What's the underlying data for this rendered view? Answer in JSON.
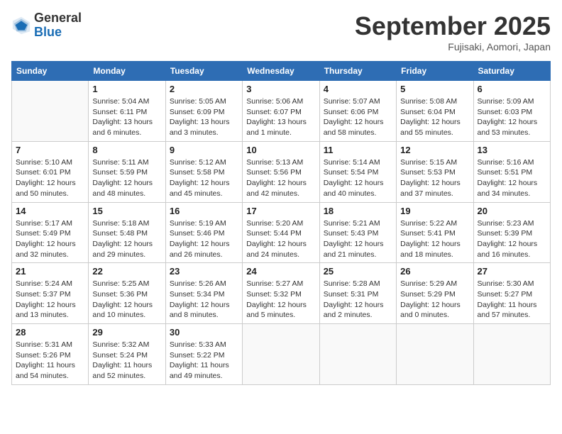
{
  "header": {
    "logo": {
      "general": "General",
      "blue": "Blue"
    },
    "title": "September 2025",
    "subtitle": "Fujisaki, Aomori, Japan"
  },
  "days_of_week": [
    "Sunday",
    "Monday",
    "Tuesday",
    "Wednesday",
    "Thursday",
    "Friday",
    "Saturday"
  ],
  "weeks": [
    [
      {
        "day": "",
        "info": ""
      },
      {
        "day": "1",
        "info": "Sunrise: 5:04 AM\nSunset: 6:11 PM\nDaylight: 13 hours\nand 6 minutes."
      },
      {
        "day": "2",
        "info": "Sunrise: 5:05 AM\nSunset: 6:09 PM\nDaylight: 13 hours\nand 3 minutes."
      },
      {
        "day": "3",
        "info": "Sunrise: 5:06 AM\nSunset: 6:07 PM\nDaylight: 13 hours\nand 1 minute."
      },
      {
        "day": "4",
        "info": "Sunrise: 5:07 AM\nSunset: 6:06 PM\nDaylight: 12 hours\nand 58 minutes."
      },
      {
        "day": "5",
        "info": "Sunrise: 5:08 AM\nSunset: 6:04 PM\nDaylight: 12 hours\nand 55 minutes."
      },
      {
        "day": "6",
        "info": "Sunrise: 5:09 AM\nSunset: 6:03 PM\nDaylight: 12 hours\nand 53 minutes."
      }
    ],
    [
      {
        "day": "7",
        "info": "Sunrise: 5:10 AM\nSunset: 6:01 PM\nDaylight: 12 hours\nand 50 minutes."
      },
      {
        "day": "8",
        "info": "Sunrise: 5:11 AM\nSunset: 5:59 PM\nDaylight: 12 hours\nand 48 minutes."
      },
      {
        "day": "9",
        "info": "Sunrise: 5:12 AM\nSunset: 5:58 PM\nDaylight: 12 hours\nand 45 minutes."
      },
      {
        "day": "10",
        "info": "Sunrise: 5:13 AM\nSunset: 5:56 PM\nDaylight: 12 hours\nand 42 minutes."
      },
      {
        "day": "11",
        "info": "Sunrise: 5:14 AM\nSunset: 5:54 PM\nDaylight: 12 hours\nand 40 minutes."
      },
      {
        "day": "12",
        "info": "Sunrise: 5:15 AM\nSunset: 5:53 PM\nDaylight: 12 hours\nand 37 minutes."
      },
      {
        "day": "13",
        "info": "Sunrise: 5:16 AM\nSunset: 5:51 PM\nDaylight: 12 hours\nand 34 minutes."
      }
    ],
    [
      {
        "day": "14",
        "info": "Sunrise: 5:17 AM\nSunset: 5:49 PM\nDaylight: 12 hours\nand 32 minutes."
      },
      {
        "day": "15",
        "info": "Sunrise: 5:18 AM\nSunset: 5:48 PM\nDaylight: 12 hours\nand 29 minutes."
      },
      {
        "day": "16",
        "info": "Sunrise: 5:19 AM\nSunset: 5:46 PM\nDaylight: 12 hours\nand 26 minutes."
      },
      {
        "day": "17",
        "info": "Sunrise: 5:20 AM\nSunset: 5:44 PM\nDaylight: 12 hours\nand 24 minutes."
      },
      {
        "day": "18",
        "info": "Sunrise: 5:21 AM\nSunset: 5:43 PM\nDaylight: 12 hours\nand 21 minutes."
      },
      {
        "day": "19",
        "info": "Sunrise: 5:22 AM\nSunset: 5:41 PM\nDaylight: 12 hours\nand 18 minutes."
      },
      {
        "day": "20",
        "info": "Sunrise: 5:23 AM\nSunset: 5:39 PM\nDaylight: 12 hours\nand 16 minutes."
      }
    ],
    [
      {
        "day": "21",
        "info": "Sunrise: 5:24 AM\nSunset: 5:37 PM\nDaylight: 12 hours\nand 13 minutes."
      },
      {
        "day": "22",
        "info": "Sunrise: 5:25 AM\nSunset: 5:36 PM\nDaylight: 12 hours\nand 10 minutes."
      },
      {
        "day": "23",
        "info": "Sunrise: 5:26 AM\nSunset: 5:34 PM\nDaylight: 12 hours\nand 8 minutes."
      },
      {
        "day": "24",
        "info": "Sunrise: 5:27 AM\nSunset: 5:32 PM\nDaylight: 12 hours\nand 5 minutes."
      },
      {
        "day": "25",
        "info": "Sunrise: 5:28 AM\nSunset: 5:31 PM\nDaylight: 12 hours\nand 2 minutes."
      },
      {
        "day": "26",
        "info": "Sunrise: 5:29 AM\nSunset: 5:29 PM\nDaylight: 12 hours\nand 0 minutes."
      },
      {
        "day": "27",
        "info": "Sunrise: 5:30 AM\nSunset: 5:27 PM\nDaylight: 11 hours\nand 57 minutes."
      }
    ],
    [
      {
        "day": "28",
        "info": "Sunrise: 5:31 AM\nSunset: 5:26 PM\nDaylight: 11 hours\nand 54 minutes."
      },
      {
        "day": "29",
        "info": "Sunrise: 5:32 AM\nSunset: 5:24 PM\nDaylight: 11 hours\nand 52 minutes."
      },
      {
        "day": "30",
        "info": "Sunrise: 5:33 AM\nSunset: 5:22 PM\nDaylight: 11 hours\nand 49 minutes."
      },
      {
        "day": "",
        "info": ""
      },
      {
        "day": "",
        "info": ""
      },
      {
        "day": "",
        "info": ""
      },
      {
        "day": "",
        "info": ""
      }
    ]
  ]
}
